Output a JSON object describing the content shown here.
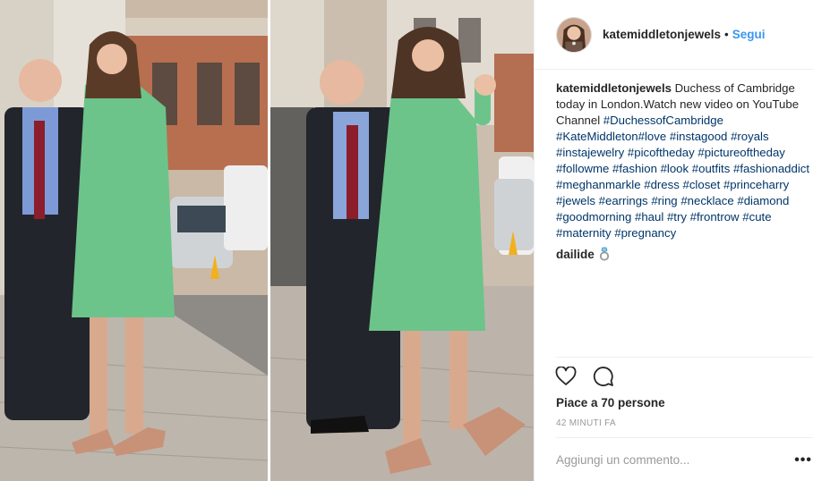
{
  "header": {
    "username": "katemiddletonjewels",
    "separator": "•",
    "follow_label": "Segui",
    "avatar_icon": "profile-avatar"
  },
  "caption": {
    "username": "katemiddletonjewels",
    "text": "Duchess of Cambridge today in London.Watch new video on YouTube Channel",
    "hashtags": [
      "#DuchessofCambridge",
      "#KateMiddleton",
      "#love",
      "#instagood",
      "#royals",
      "#instajewelry",
      "#picoftheday",
      "#pictureoftheday",
      "#followme",
      "#fashion",
      "#look",
      "#outfits",
      "#fashionaddict",
      "#meghanmarkle",
      "#dress",
      "#closet",
      "#princeharry",
      "#jewels",
      "#earrings",
      "#ring",
      "#necklace",
      "#diamond",
      "#goodmorning",
      "#haul",
      "#try",
      "#frontrow",
      "#cute",
      "#maternity",
      "#pregnancy"
    ]
  },
  "comment": {
    "username": "dailide",
    "emoji_icon": "ring-icon"
  },
  "actions": {
    "like_icon": "heart-icon",
    "comment_icon": "comment-icon"
  },
  "likes_text": "Piace a 70 persone",
  "timestamp": "42 MINUTI FA",
  "comment_input": {
    "placeholder": "Aggiungi un commento...",
    "value": ""
  },
  "more_label": "•••",
  "colors": {
    "link_blue": "#3897f0",
    "hashtag": "#003569",
    "text": "#262626",
    "muted": "#999999",
    "coat_green": "#6cc48a"
  }
}
